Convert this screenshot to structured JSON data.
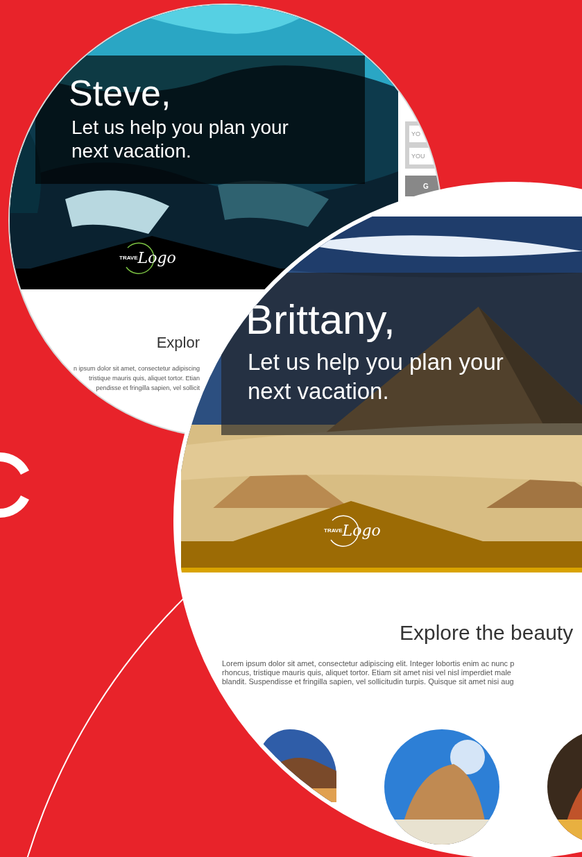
{
  "card_back": {
    "greeting": "Steve,",
    "tagline_lines": [
      "Let us help you plan your",
      "next vacation."
    ],
    "logo": {
      "prefix": "TRAVE",
      "name": "Logo"
    },
    "form": {
      "fields": [
        {
          "placeholder": "YO"
        },
        {
          "placeholder": "YOU"
        }
      ],
      "button": "G"
    },
    "heading": "Explor",
    "paragraph_lines": [
      "n ipsum dolor sit amet, consectetur adipiscing",
      "tristique mauris quis, aliquet tortor. Etian",
      "pendisse et fringilla sapien, vel sollicit"
    ]
  },
  "card_front": {
    "greeting": "Brittany,",
    "tagline_lines": [
      "Let us help you plan your",
      "next vacation."
    ],
    "logo": {
      "prefix": "TRAVE",
      "name": "Logo"
    },
    "heading": "Explore the beauty",
    "paragraph_lines": [
      "Lorem ipsum dolor sit amet, consectetur adipiscing elit. Integer lobortis enim ac nunc p",
      "rhoncus, tristique mauris quis, aliquet tortor. Etiam sit amet nisi vel nisl imperdiet male",
      "blandit. Suspendisse et fringilla sapien, vel sollicitudin turpis. Quisque sit amet nisi aug"
    ],
    "thumbnails": [
      {
        "kind": "picture"
      },
      {
        "kind": "picture"
      },
      {
        "kind": "picture"
      }
    ]
  }
}
